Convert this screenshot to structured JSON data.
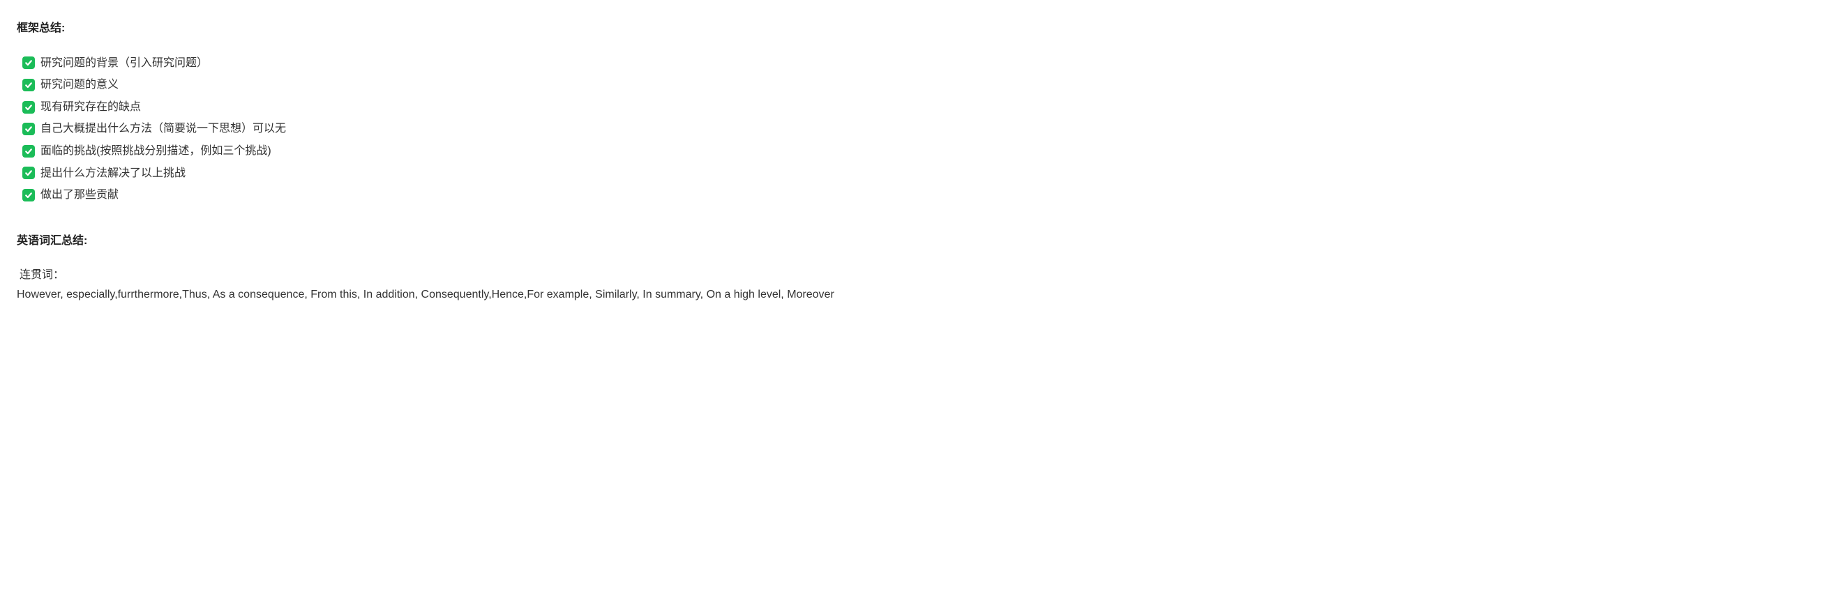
{
  "section1": {
    "heading": "框架总结:",
    "items": [
      "研究问题的背景（引入研究问题）",
      "研究问题的意义",
      "现有研究存在的缺点",
      "自己大概提出什么方法（简要说一下思想）可以无",
      "面临的挑战(按照挑战分别描述，例如三个挑战)",
      "提出什么方法解决了以上挑战",
      "做出了那些贡献"
    ]
  },
  "section2": {
    "heading": "英语词汇总结:",
    "subheading": "连贯词：",
    "body": "However, especially,furrthermore,Thus, As a consequence, From this, In addition, Consequently,Hence,For example, Similarly, In summary, On a high level, Moreover"
  }
}
